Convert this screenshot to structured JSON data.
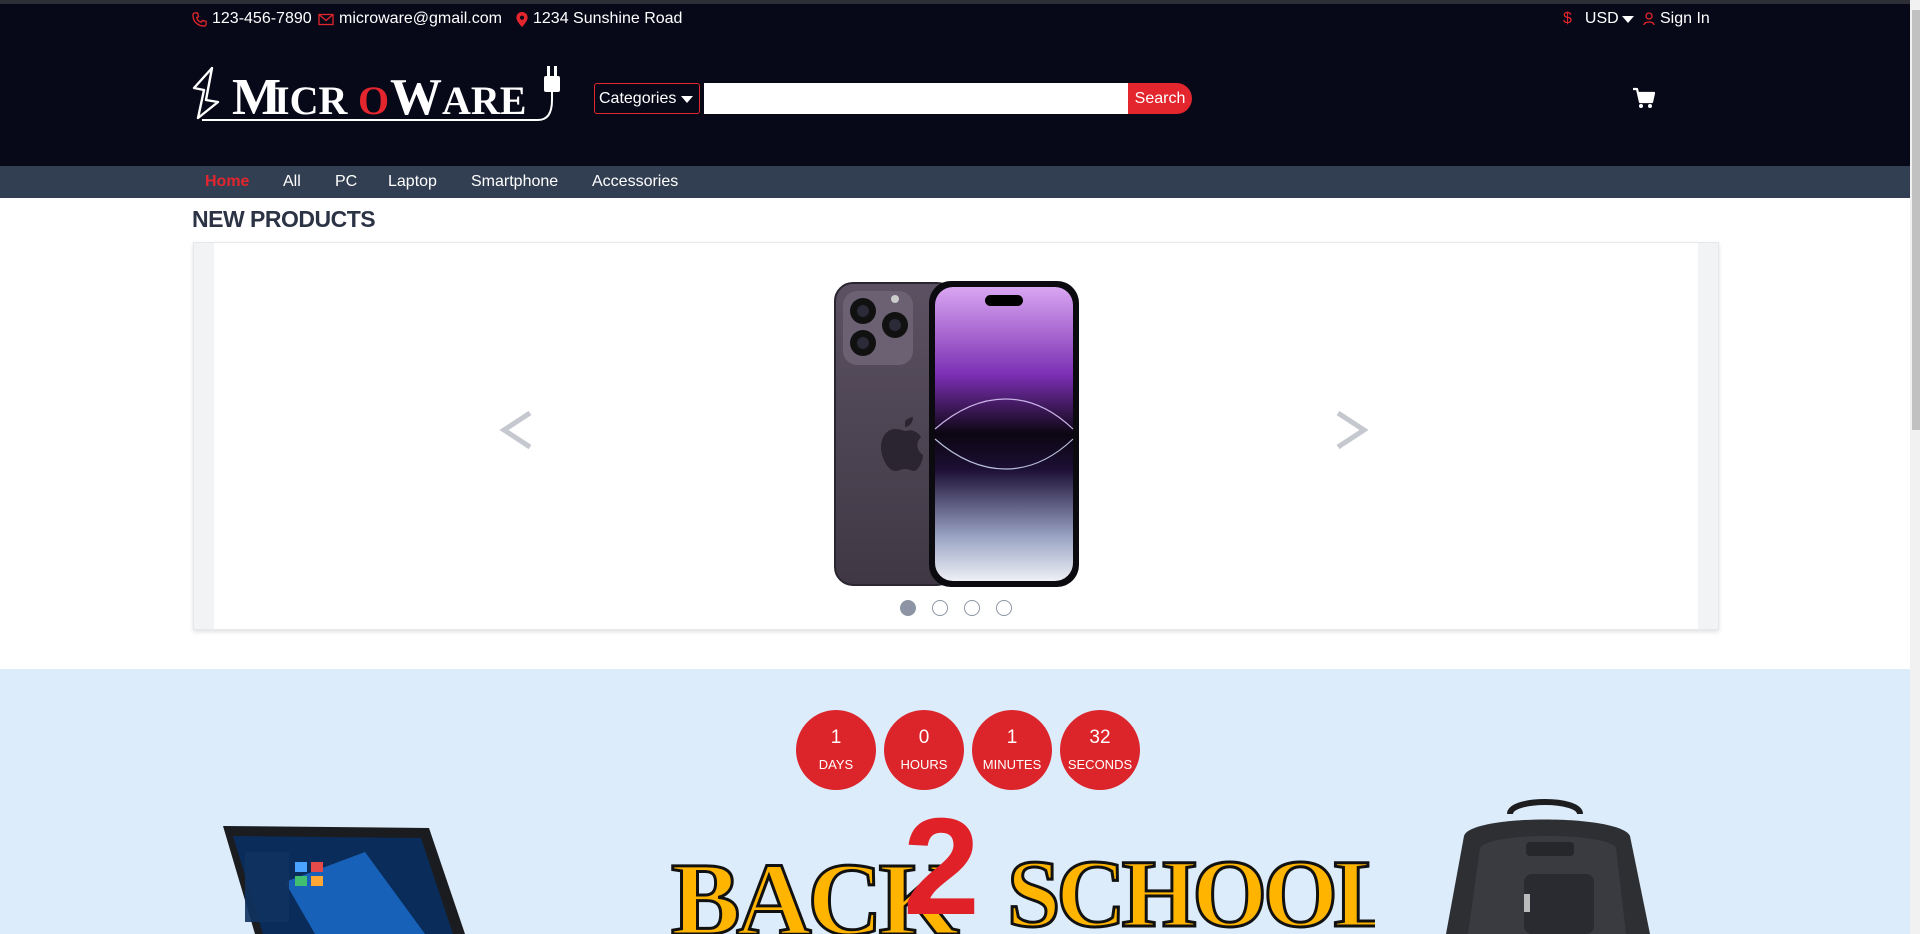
{
  "contact": {
    "phone": "123-456-7890",
    "email": "microware@gmail.com",
    "address": "1234 Sunshine Road",
    "currency_symbol": "$",
    "currency": "USD",
    "signin": "Sign In"
  },
  "logo": {
    "text": "MICROWARE"
  },
  "search": {
    "category_label": "Categories",
    "placeholder": "",
    "button": "Search"
  },
  "nav": {
    "items": [
      "Home",
      "All",
      "PC",
      "Laptop",
      "Smartphone",
      "Accessories"
    ],
    "active": "Home"
  },
  "new_products": {
    "title": "NEW PRODUCTS",
    "prev": "<",
    "next": ">",
    "slide_count": 4,
    "active_slide": 1
  },
  "countdown": [
    {
      "value": "1",
      "label": "DAYS"
    },
    {
      "value": "0",
      "label": "HOURS"
    },
    {
      "value": "1",
      "label": "MINUTES"
    },
    {
      "value": "32",
      "label": "SECONDS"
    }
  ],
  "promo": {
    "banner": "BACK2SCHOOL"
  },
  "colors": {
    "accent": "#e3262d",
    "header_bg": "#070818",
    "nav_bg": "#323f52",
    "promo_bg": "#dcecfa"
  }
}
